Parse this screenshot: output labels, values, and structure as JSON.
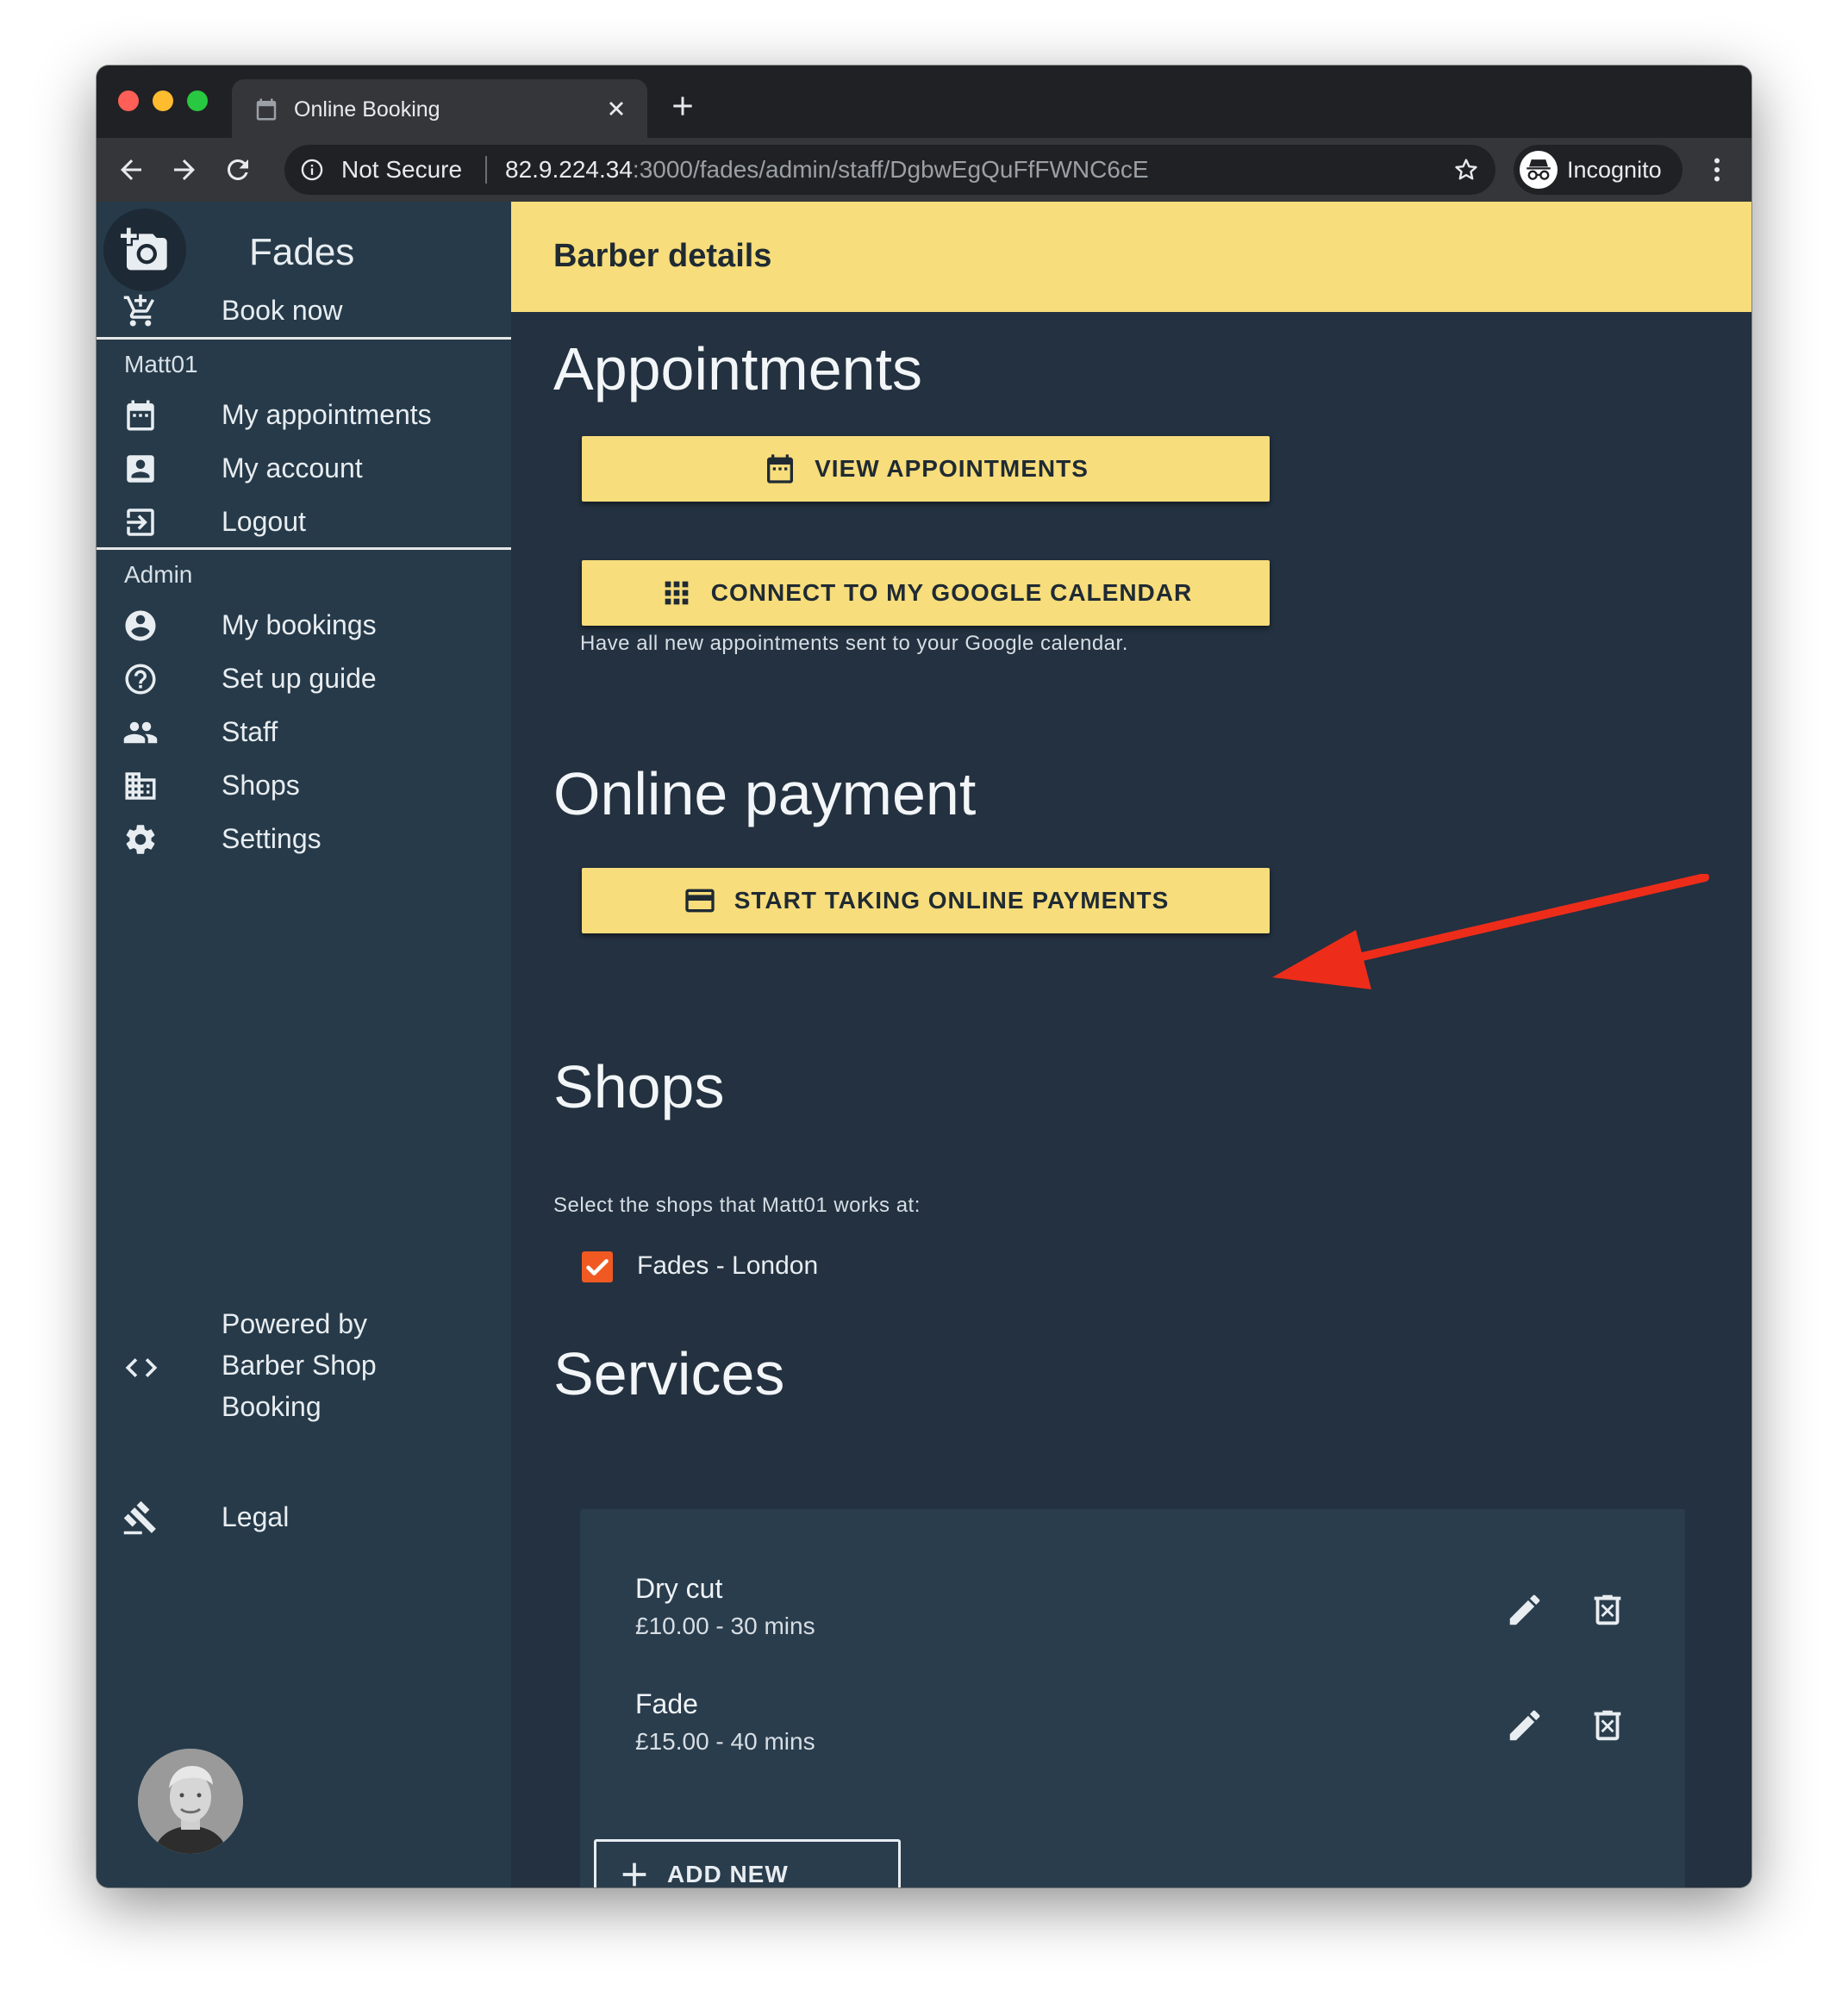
{
  "browser": {
    "tab_title": "Online Booking",
    "security_label": "Not Secure",
    "url_host": "82.9.224.34",
    "url_path": ":3000/fades/admin/staff/DgbwEgQuFfFWNC6cE",
    "profile_label": "Incognito"
  },
  "sidebar": {
    "brand": "Fades",
    "book_now": "Book now",
    "user_section": "Matt01",
    "user_items": [
      {
        "label": "My appointments",
        "icon": "calendar-icon"
      },
      {
        "label": "My account",
        "icon": "account-box-icon"
      },
      {
        "label": "Logout",
        "icon": "logout-icon"
      }
    ],
    "admin_section": "Admin",
    "admin_items": [
      {
        "label": "My bookings",
        "icon": "account-circle-icon"
      },
      {
        "label": "Set up guide",
        "icon": "help-icon"
      },
      {
        "label": "Staff",
        "icon": "people-icon"
      },
      {
        "label": "Shops",
        "icon": "building-icon"
      },
      {
        "label": "Settings",
        "icon": "gear-icon"
      }
    ],
    "powered_by": "Powered by Barber Shop Booking",
    "legal": "Legal"
  },
  "main": {
    "header_title": "Barber details",
    "appointments_heading": "Appointments",
    "view_appointments_label": "VIEW APPOINTMENTS",
    "google_calendar_label": "CONNECT TO MY GOOGLE CALENDAR",
    "google_calendar_help": "Have all new appointments sent to your Google calendar.",
    "payment_heading": "Online payment",
    "payment_button_label": "START TAKING ONLINE PAYMENTS",
    "shops_heading": "Shops",
    "shops_subtitle": "Select the shops that Matt01 works at:",
    "shops": [
      {
        "label": "Fades - London",
        "checked": true
      }
    ],
    "services_heading": "Services",
    "services": [
      {
        "name": "Dry cut",
        "detail": "£10.00 - 30 mins"
      },
      {
        "name": "Fade",
        "detail": "£15.00 - 40 mins"
      }
    ],
    "add_service_label": "ADD NEW SERVICE"
  },
  "colors": {
    "accent_yellow": "#f7dd7b",
    "sidebar_bg": "#263a49",
    "main_bg": "#233140",
    "checkbox_orange": "#f05a22",
    "annotation_arrow": "#ee2c1a"
  }
}
